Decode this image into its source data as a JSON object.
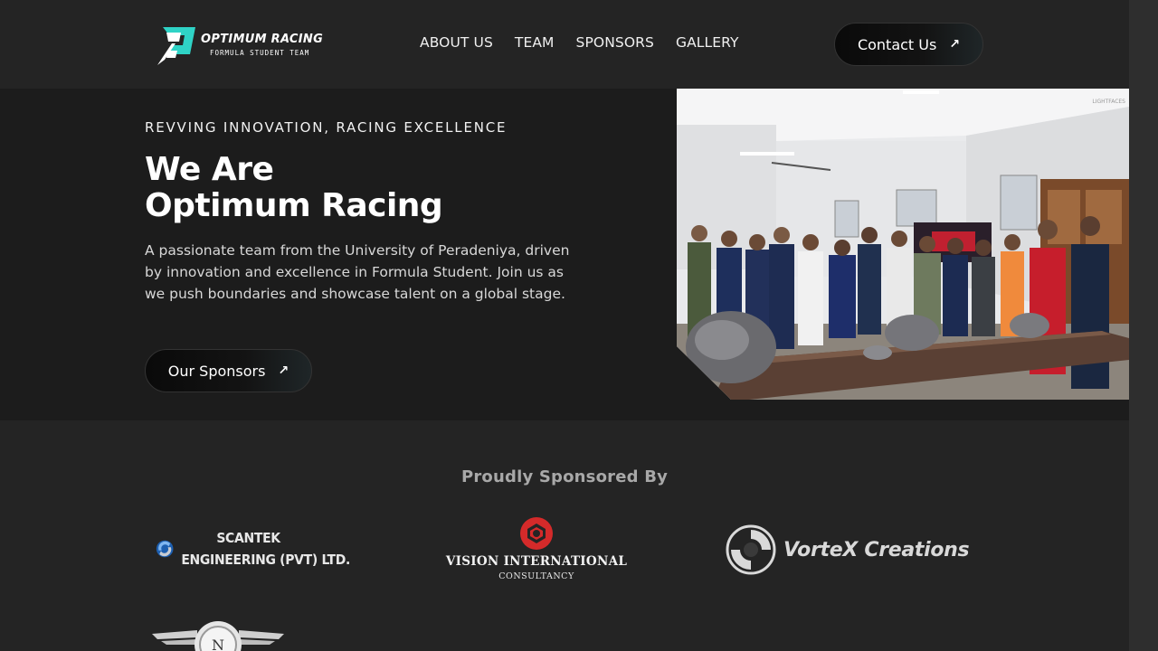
{
  "nav": {
    "logo": {
      "title": "OPTIMUM RACING",
      "subtitle": "FORMULA STUDENT TEAM",
      "icon": "optimum-racing-emblem",
      "accent": "#2fd3c6"
    },
    "links": [
      "ABOUT US",
      "TEAM",
      "SPONSORS",
      "GALLERY"
    ],
    "contact_label": "Contact Us",
    "contact_icon": "arrow-up-right-icon"
  },
  "hero": {
    "eyebrow": "REVVING INNOVATION, RACING EXCELLENCE",
    "headline_line1": "We Are",
    "headline_line2": "Optimum Racing",
    "description": "A passionate team from the University of Peradeniya, driven by innovation and excellence in Formula Student. Join us as we push boundaries and showcase talent on a global stage.",
    "cta_label": "Our Sponsors",
    "cta_icon": "arrow-up-right-icon",
    "photo_watermark": "LIGHTFACES"
  },
  "sponsors": {
    "heading": "Proudly Sponsored By",
    "items": [
      {
        "line1": "SCANTEK",
        "line2": "ENGINEERING (PVT) LTD.",
        "icon": "scantek-swirl-logo"
      },
      {
        "line1": "VISION INTERNATIONAL",
        "line2": "CONSULTANCY",
        "icon": "camera-aperture-logo",
        "color": "#d42a2a"
      },
      {
        "line1": "VorteX Creations",
        "icon": "vortex-spiral-logo"
      },
      {
        "line1": "N",
        "icon": "winged-badge-logo"
      }
    ]
  },
  "colors": {
    "nav_bg": "#242424",
    "hero_bg": "#1c1c1c",
    "accent_teal": "#2fd3c6",
    "scantek_blue": "#2a7ad4",
    "vision_red": "#d42a2a"
  }
}
